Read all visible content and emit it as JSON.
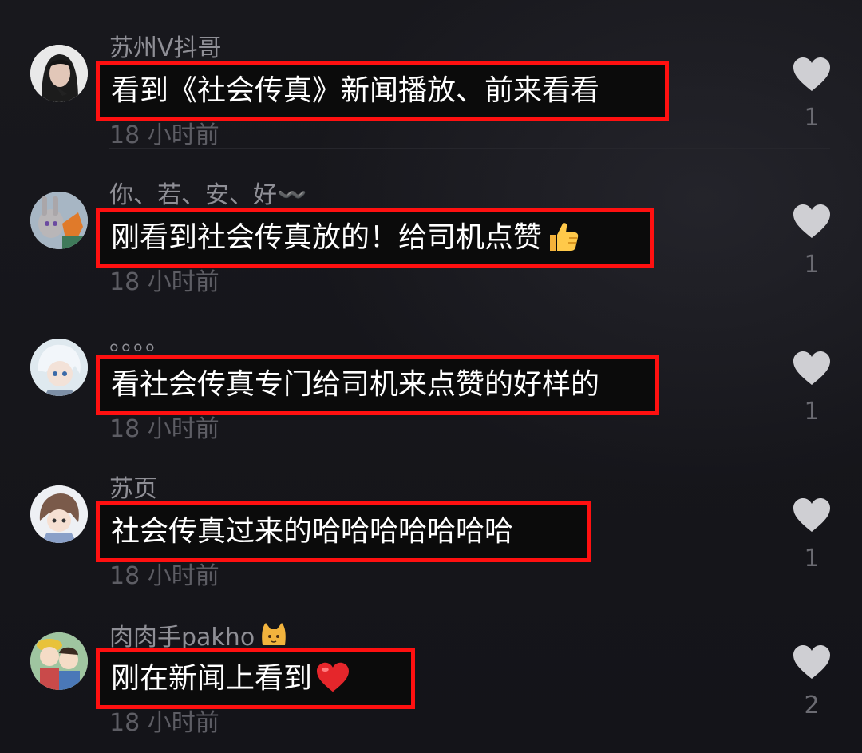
{
  "comments": [
    {
      "username": "苏州V抖哥",
      "text": "看到《社会传真》新闻播放、前来看看",
      "time": "18 小时前",
      "likes": "1",
      "avatar_icon": "woman-portrait-avatar"
    },
    {
      "username": "你、若、安、好〰️",
      "text": "刚看到社会传真放的！给司机点赞",
      "text_emoji": "thumbs-up-icon",
      "time": "18 小时前",
      "likes": "1",
      "avatar_icon": "cartoon-rabbit-fox-avatar"
    },
    {
      "username": "。。。。",
      "text": "看社会传真专门给司机来点赞的好样的",
      "time": "18 小时前",
      "likes": "1",
      "avatar_icon": "anime-white-hair-avatar"
    },
    {
      "username": "苏页",
      "text": "社会传真过来的哈哈哈哈哈哈哈",
      "time": "18 小时前",
      "likes": "1",
      "avatar_icon": "cartoon-child-avatar"
    },
    {
      "username": "肉肉手pakho",
      "username_emoji": "cat-face-icon",
      "text": "刚在新闻上看到",
      "text_emoji": "red-heart-icon",
      "time": "18 小时前",
      "likes": "2",
      "avatar_icon": "cartoon-two-kids-avatar"
    }
  ],
  "colors": {
    "background": "#16161b",
    "highlight_border": "#ff1010",
    "username": "#8f8f96",
    "time": "#5d5d64",
    "heart": "#cfcfd3"
  }
}
